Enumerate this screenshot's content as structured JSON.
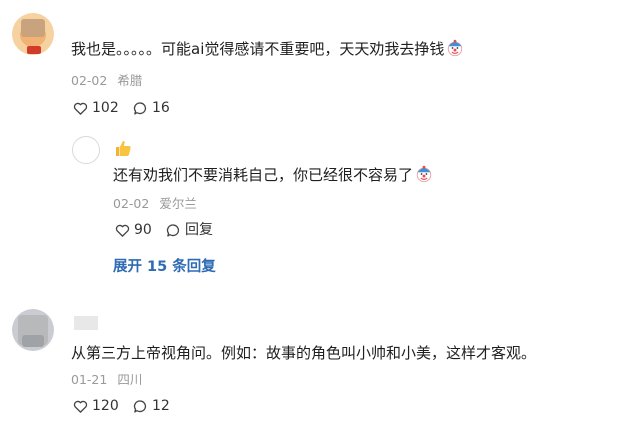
{
  "comments": [
    {
      "text": "我也是。。。。。可能ai觉得感请不重要吧，天天劝我去挣钱",
      "date": "02-02",
      "location": "希腊",
      "likes": "102",
      "replies": "16",
      "emoji": "clown-face-icon"
    },
    {
      "text": "还有劝我们不要消耗自己，你已经很不容易了",
      "date": "02-02",
      "location": "爱尔兰",
      "likes": "90",
      "reply_label": "回复",
      "emoji": "clown-face-icon",
      "reaction": "thumbs-up-icon"
    },
    {
      "text": "从第三方上帝视角问。例如：故事的角色叫小帅和小美，这样才客观。",
      "date": "01-21",
      "location": "四川",
      "likes": "120",
      "replies": "12"
    }
  ],
  "expand_replies": "展开 15 条回复",
  "colors": {
    "link": "#2f6bb5",
    "meta": "#999999",
    "text": "#1f1f1f"
  }
}
